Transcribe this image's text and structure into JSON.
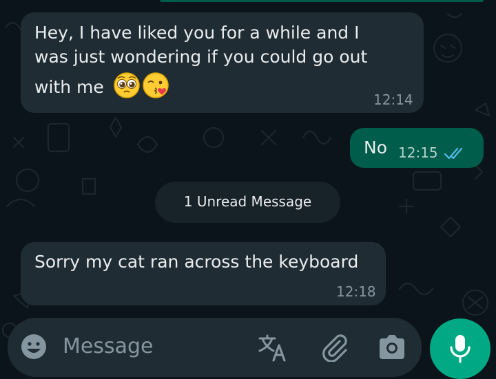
{
  "theme": {
    "background": "#0b141a",
    "incoming_bubble": "#202c33",
    "outgoing_bubble": "#005c4b",
    "accent": "#00a884",
    "read_tick": "#53bdeb"
  },
  "messages": [
    {
      "direction": "incoming",
      "lines": [
        "Hey, I have liked you for a while and I",
        "was just wondering if you could go out",
        "with me"
      ],
      "emojis": [
        "pleading-face-emoji",
        "face-blowing-kiss-emoji"
      ],
      "time": "12:14"
    },
    {
      "direction": "outgoing",
      "text": "No",
      "time": "12:15",
      "status_icon": "double-check-read-icon"
    },
    {
      "direction": "incoming",
      "text": "Sorry my cat ran across the keyboard",
      "time": "12:18"
    }
  ],
  "unread_divider": {
    "label": "1 Unread Message"
  },
  "composer": {
    "placeholder": "Message",
    "icons": [
      "emoji-icon",
      "translate-icon",
      "attach-paperclip-icon",
      "camera-icon"
    ],
    "send_icon": "microphone-icon"
  }
}
